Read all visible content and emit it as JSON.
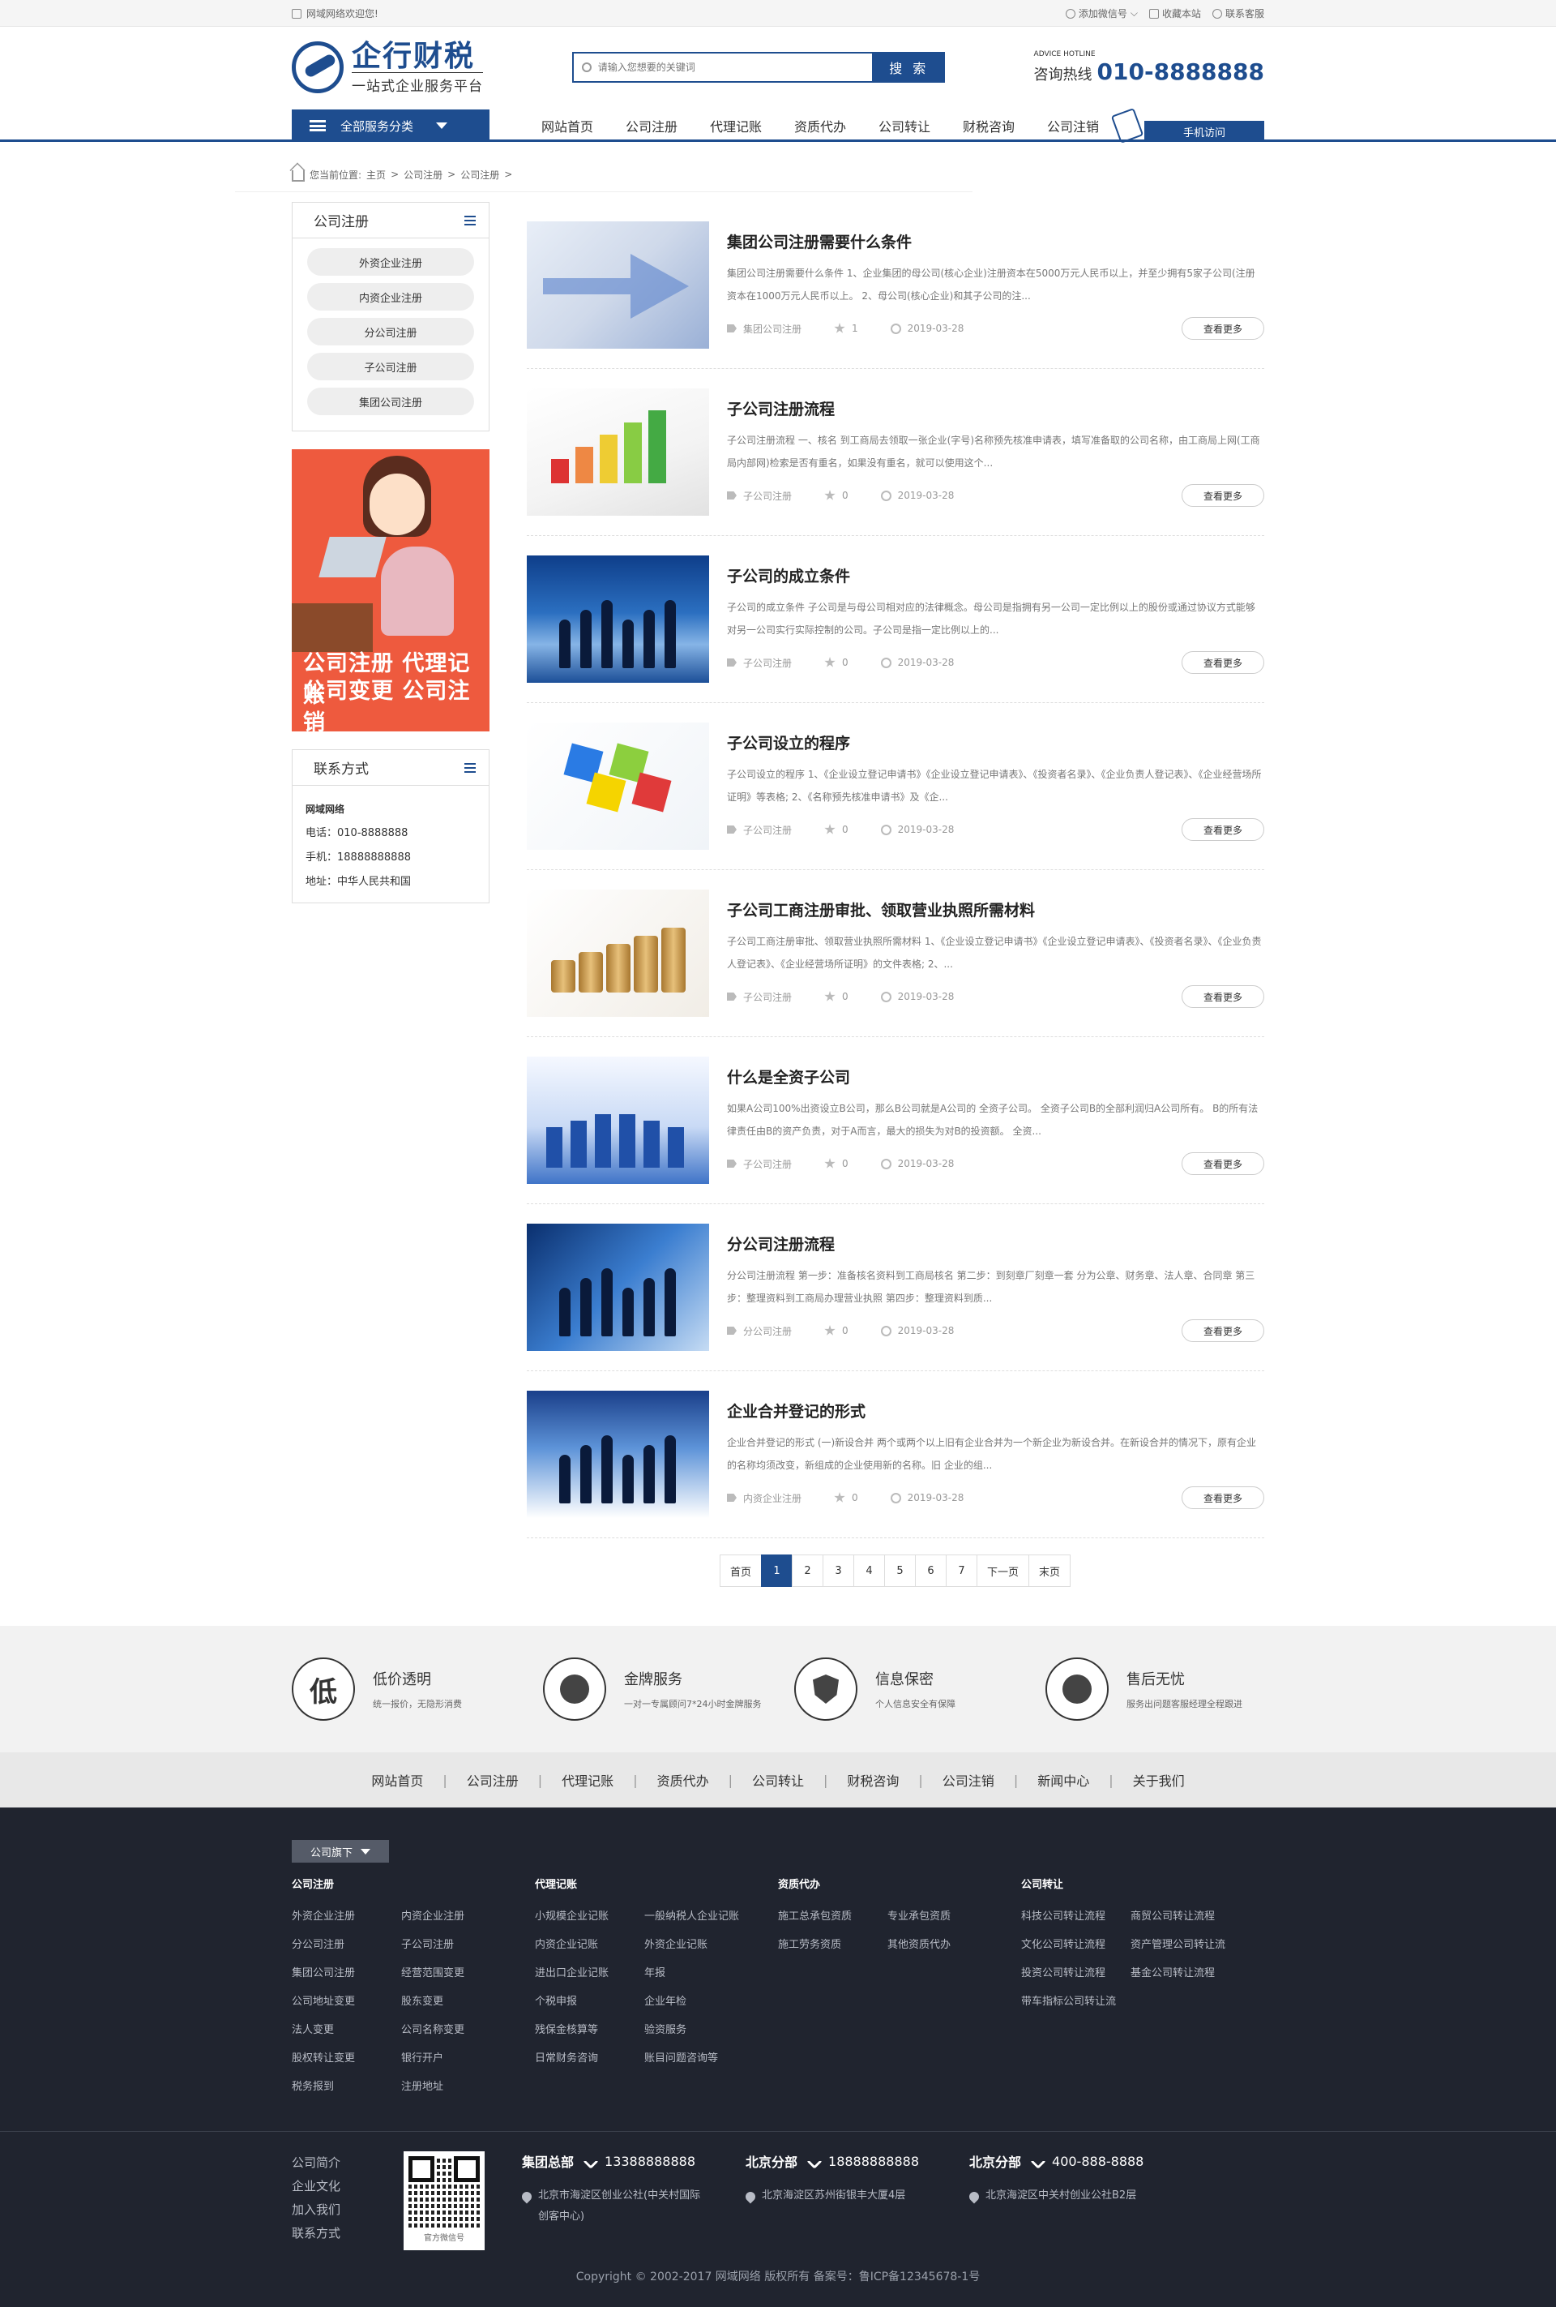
{
  "topbar": {
    "welcome": "网域网络欢迎您!",
    "wechat": "添加微信号",
    "favorite": "收藏本站",
    "report": "联系客服"
  },
  "logo": {
    "name": "企行财税",
    "tagline": "一站式企业服务平台"
  },
  "search": {
    "placeholder": "请输入您想要的关键词",
    "button": "搜 索"
  },
  "hotline": {
    "en": "ADVICE HOTLINE",
    "label": "咨询热线",
    "number": "010-8888888"
  },
  "nav": {
    "all": "全部服务分类",
    "links": [
      "网站首页",
      "公司注册",
      "代理记账",
      "资质代办",
      "公司转让",
      "财税咨询",
      "公司注销"
    ],
    "mobile": "手机访问"
  },
  "breadcrumb": [
    "您当前位置:",
    "主页",
    ">",
    "公司注册",
    ">",
    "公司注册",
    ">"
  ],
  "sidebar": {
    "title": "公司注册",
    "items": [
      "外资企业注册",
      "内资企业注册",
      "分公司注册",
      "子公司注册",
      "集团公司注册"
    ],
    "banner": {
      "line1": "公司注册  代理记账",
      "line2": "公司变更  公司注销"
    },
    "contact": {
      "title": "联系方式",
      "company": "网域网络",
      "phone": "电话：010-8888888",
      "mobile": "手机：18888888888",
      "address": "地址：中华人民共和国"
    }
  },
  "articles": [
    {
      "title": "集团公司注册需要什么条件",
      "summary": "集团公司注册需要什么条件 1、企业集团的母公司(核心企业)注册资本在5000万元人民币以上，并至少拥有5家子公司(注册资本在1000万元人民币以上。 2、母公司(核心企业)和其子公司的注...",
      "category": "集团公司注册",
      "stars": "1",
      "date": "2019-03-28",
      "more": "查看更多",
      "thumb": "arrows"
    },
    {
      "title": "子公司注册流程",
      "summary": "子公司注册流程 一、核名 到工商局去领取一张企业(字号)名称预先核准申请表，填写准备取的公司名称，由工商局上网(工商局内部网)检索是否有重名，如果没有重名，就可以使用这个...",
      "category": "子公司注册",
      "stars": "0",
      "date": "2019-03-28",
      "more": "查看更多",
      "thumb": "chart"
    },
    {
      "title": "子公司的成立条件",
      "summary": "子公司的成立条件 子公司是与母公司相对应的法律概念。母公司是指拥有另一公司一定比例以上的股份或通过协议方式能够对另一公司实行实际控制的公司。子公司是指一定比例以上的...",
      "category": "子公司注册",
      "stars": "0",
      "date": "2019-03-28",
      "more": "查看更多",
      "thumb": "city"
    },
    {
      "title": "子公司设立的程序",
      "summary": "子公司设立的程序 1、《企业设立登记申请书》《企业设立登记申请表》、《投资者名录》、《企业负责人登记表》、《企业经营场所证明》等表格; 2、《名称预先核准申请书》及《企...",
      "category": "子公司注册",
      "stars": "0",
      "date": "2019-03-28",
      "more": "查看更多",
      "thumb": "cubes"
    },
    {
      "title": "子公司工商注册审批、领取营业执照所需材料",
      "summary": "子公司工商注册审批、领取营业执照所需材料 1、《企业设立登记申请书》《企业设立登记申请表》、《投资者名录》、《企业负责人登记表》、《企业经营场所证明》的文件表格; 2、...",
      "category": "子公司注册",
      "stars": "0",
      "date": "2019-03-28",
      "more": "查看更多",
      "thumb": "coins"
    },
    {
      "title": "什么是全资子公司",
      "summary": "如果A公司100%出资设立B公司，那么B公司就是A公司的 全资子公司。 全资子公司B的全部利润归A公司所有。 B的所有法律责任由B的资产负责，对于A而言，最大的损失为对B的投资额。 全资...",
      "category": "子公司注册",
      "stars": "0",
      "date": "2019-03-28",
      "more": "查看更多",
      "thumb": "servers"
    },
    {
      "title": "分公司注册流程",
      "summary": "分公司注册流程 第一步：准备核名资料到工商局核名 第二步：到刻章厂刻章一套 分为公章、财务章、法人章、合同章 第三步：整理资料到工商局办理营业执照 第四步：整理资料到质...",
      "category": "分公司注册",
      "stars": "0",
      "date": "2019-03-28",
      "more": "查看更多",
      "thumb": "people"
    },
    {
      "title": "企业合并登记的形式",
      "summary": "企业合并登记的形式 (一)新设合并 两个或两个以上旧有企业合并为一个新企业为新设合并。在新设合并的情况下，原有企业的名称均须改变，新组成的企业使用新的名称。旧 企业的组...",
      "category": "内资企业注册",
      "stars": "0",
      "date": "2019-03-28",
      "more": "查看更多",
      "thumb": "globe"
    }
  ],
  "pager": [
    "首页",
    "1",
    "2",
    "3",
    "4",
    "5",
    "6",
    "7",
    "下一页",
    "末页"
  ],
  "features": [
    {
      "icon": "低",
      "title": "低价透明",
      "desc": "统一报价，无隐形消费"
    },
    {
      "icon": "medal",
      "title": "金牌服务",
      "desc": "一对一专属顾问7*24小时金牌服务"
    },
    {
      "icon": "shield",
      "title": "信息保密",
      "desc": "个人信息安全有保障"
    },
    {
      "icon": "heart",
      "title": "售后无忧",
      "desc": "服务出问题客服经理全程跟进"
    }
  ],
  "footnav": [
    "网站首页",
    "公司注册",
    "代理记账",
    "资质代办",
    "公司转让",
    "财税咨询",
    "公司注销",
    "新闻中心",
    "关于我们"
  ],
  "footer": {
    "tab": "公司旗下",
    "cols": [
      {
        "title": "公司注册",
        "items": [
          "外资企业注册",
          "内资企业注册",
          "分公司注册",
          "子公司注册",
          "集团公司注册",
          "经营范围变更",
          "公司地址变更",
          "股东变更",
          "法人变更",
          "公司名称变更",
          "股权转让变更",
          "银行开户",
          "税务报到",
          "注册地址"
        ]
      },
      {
        "title": "代理记账",
        "items": [
          "小规模企业记账",
          "一般纳税人企业记账",
          "内资企业记账",
          "外资企业记账",
          "进出口企业记账",
          "年报",
          "个税申报",
          "企业年检",
          "残保金核算等",
          "验资服务",
          "日常财务咨询",
          "账目问题咨询等"
        ]
      },
      {
        "title": "资质代办",
        "items": [
          "施工总承包资质",
          "专业承包资质",
          "施工劳务资质",
          "其他资质代办"
        ]
      },
      {
        "title": "公司转让",
        "items": [
          "科技公司转让流程",
          "商贸公司转让流程",
          "文化公司转让流程",
          "资产管理公司转让流",
          "投资公司转让流程",
          "基金公司转让流程",
          "带车指标公司转让流"
        ]
      }
    ],
    "links": [
      "公司简介",
      "企业文化",
      "加入我们",
      "联系方式"
    ],
    "qr_caption": "官方微信号",
    "branches": [
      {
        "name": "集团总部",
        "phone": "13388888888",
        "address": "北京市海淀区创业公社(中关村国际创客中心)"
      },
      {
        "name": "北京分部",
        "phone": "18888888888",
        "address": "北京海淀区苏州街银丰大厦4层"
      },
      {
        "name": "北京分部",
        "phone": "400-888-8888",
        "address": "北京海淀区中关村创业公社B2层"
      }
    ],
    "copyright": "Copyright © 2002-2017 网域网络 版权所有 备案号：鲁ICP备12345678-1号"
  }
}
